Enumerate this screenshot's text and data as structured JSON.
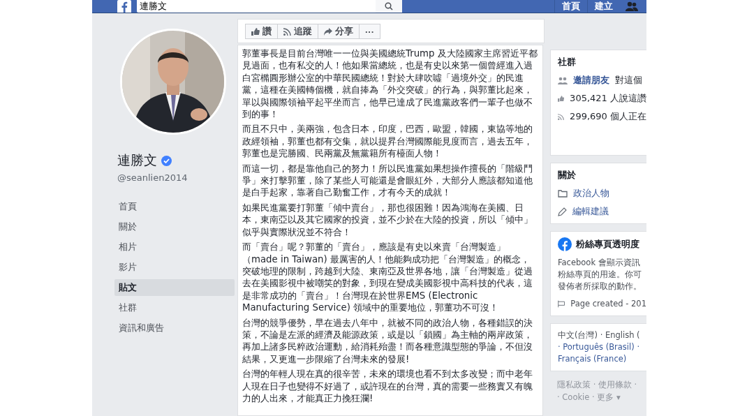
{
  "top_bar": {
    "search": {
      "value": "連勝文"
    },
    "nav": [
      "首頁",
      "建立"
    ]
  },
  "profile": {
    "name": "連勝文",
    "verified": true,
    "handle": "@seanlien2014"
  },
  "page_nav": [
    {
      "label": "首頁",
      "selected": false
    },
    {
      "label": "關於",
      "selected": false
    },
    {
      "label": "相片",
      "selected": false
    },
    {
      "label": "影片",
      "selected": false
    },
    {
      "label": "貼文",
      "selected": true
    },
    {
      "label": "社群",
      "selected": false
    },
    {
      "label": "資訊和廣告",
      "selected": false
    }
  ],
  "actions": [
    {
      "kind": "like",
      "label": "讚"
    },
    {
      "kind": "follow",
      "label": "追蹤"
    },
    {
      "kind": "share",
      "label": "分享"
    },
    {
      "kind": "more",
      "label": "···"
    }
  ],
  "post": [
    "郭董事長是目前台灣唯一一位與美國總統Trump 及大陸國家主席習近平都見過面，也有私交的人！他如果當總統，也是有史以來第一個曾經進入過白宮橢圓形辦公室的中華民國總統！對於大肆吹噓「過境外交」的民進黨，這種在美國轉個機，就自捧為「外交突破」的行為，與郭董比起來，單以與國際領袖平起平坐而言，他早已達成了民進黨政客們一輩子也做不到的事！",
    "而且不只中，美兩強，包含日本，印度，巴西，歐盟，韓國，東協等地的政經領袖，郭董也都有交集，就以提昇台灣國際能見度而言，過去五年，郭董也是完勝國、民兩黨及無黨籍所有檯面人物！",
    "而這一切，都是靠他自己的努力！所以民進黨如果想操作擅長的「階級鬥爭」來打擊郭董，除了某些人可能還是會眼紅外，大部分人應該都知道他是白手起家，靠著自己勤奮工作，才有今天的成就！",
    "如果民進黨要打郭董「傾中賣台」，那也很困難！因為鴻海在美國、日本，東南亞以及其它國家的投資，並不少於在大陸的投資，所以「傾中」似乎與實際狀況並不符合！",
    "而「賣台」呢？郭董的「賣台」，應該是有史以來賣「台灣製造」（made in Taiwan) 最厲害的人！他能夠成功把「台灣製造」的概念，突破地理的限制，跨越到大陸、東南亞及世界各地，讓「台灣製造」從過去在美國影視中被嘲笑的對象，到現在變成美國影視中高科技的代表，這是非常成功的「賣台」！台灣現在於世界EMS (Electronic Manufacturing Service) 領域中的重要地位，郭董功不可沒！",
    "台灣的競爭優勢，早在過去八年中，就被不同的政治人物，各種錯誤的決策，不論是左派的經濟及能源政策，或是以「鎖國」為主軸的兩岸政策，再加上諸多民粹政治運動，給消耗殆盡！而各種意識型態的爭論，不但沒結果，又更進一步限縮了台灣未來的發展!",
    "台灣的年輕人現在真的很辛苦，未來的環境也看不到太多改變；而中老年人現在日子也變得不好過了，或許現在的台灣，真的需要一些務實又有魄力的人出來，才能真正力挽狂瀾!"
  ],
  "community": {
    "title": "社群",
    "rows": [
      {
        "kind": "invite",
        "link": "邀請朋友",
        "text": "對這個"
      },
      {
        "kind": "like",
        "text": "305,421 人說這讚"
      },
      {
        "kind": "follow",
        "text": "299,690 個人正在"
      }
    ]
  },
  "about": {
    "title": "關於",
    "rows": [
      {
        "kind": "category",
        "text": "政治人物"
      },
      {
        "kind": "edit",
        "text": "編輯建議"
      }
    ]
  },
  "transparency": {
    "title": "粉絲專頁透明度",
    "lines": [
      "Facebook 會顯示資訊",
      "粉絲專頁的用途。你可",
      "發佈者所採取的動作。"
    ],
    "created": "Page created - 201"
  },
  "languages": [
    "中文(台灣) · English (",
    "· Português (Brasil) ·",
    "Français (France)"
  ],
  "footer": [
    "隱私政策 · 使用條款 ·",
    "· Cookie · 更多 ▾"
  ]
}
